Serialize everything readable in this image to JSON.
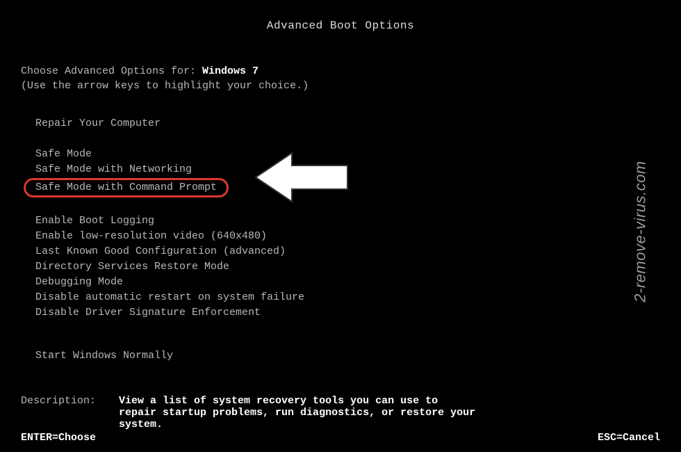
{
  "title": "Advanced Boot Options",
  "header": {
    "prefix": "Choose Advanced Options for: ",
    "os_name": "Windows 7",
    "hint": "(Use the arrow keys to highlight your choice.)"
  },
  "menu": {
    "group1": [
      "Repair Your Computer"
    ],
    "group2": [
      "Safe Mode",
      "Safe Mode with Networking",
      "Safe Mode with Command Prompt"
    ],
    "highlighted_index": 2,
    "group3": [
      "Enable Boot Logging",
      "Enable low-resolution video (640x480)",
      "Last Known Good Configuration (advanced)",
      "Directory Services Restore Mode",
      "Debugging Mode",
      "Disable automatic restart on system failure",
      "Disable Driver Signature Enforcement"
    ],
    "group4": [
      "Start Windows Normally"
    ]
  },
  "description": {
    "label": "Description:",
    "text": "View a list of system recovery tools you can use to repair startup problems, run diagnostics, or restore your system."
  },
  "footer": {
    "left": "ENTER=Choose",
    "right": "ESC=Cancel"
  },
  "watermark": "2-remove-virus.com"
}
